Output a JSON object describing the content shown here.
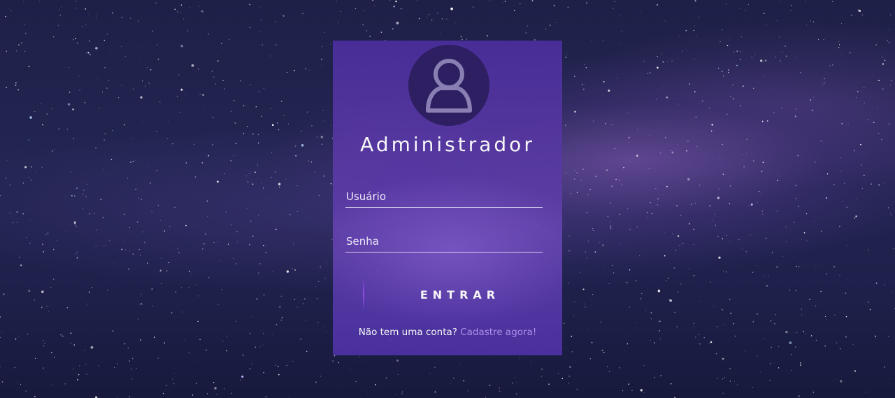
{
  "login": {
    "title": "Administrador",
    "username_placeholder": "Usuário",
    "password_placeholder": "Senha",
    "submit_label": "ENTRAR",
    "signup_prompt": "Não tem uma conta?",
    "signup_link": "Cadastre agora!"
  },
  "icons": {
    "avatar": "user-icon"
  },
  "colors": {
    "card": "#4f34a0",
    "avatar_circle": "#2f1f63",
    "link": "#b393f2",
    "text": "#ffffff"
  }
}
